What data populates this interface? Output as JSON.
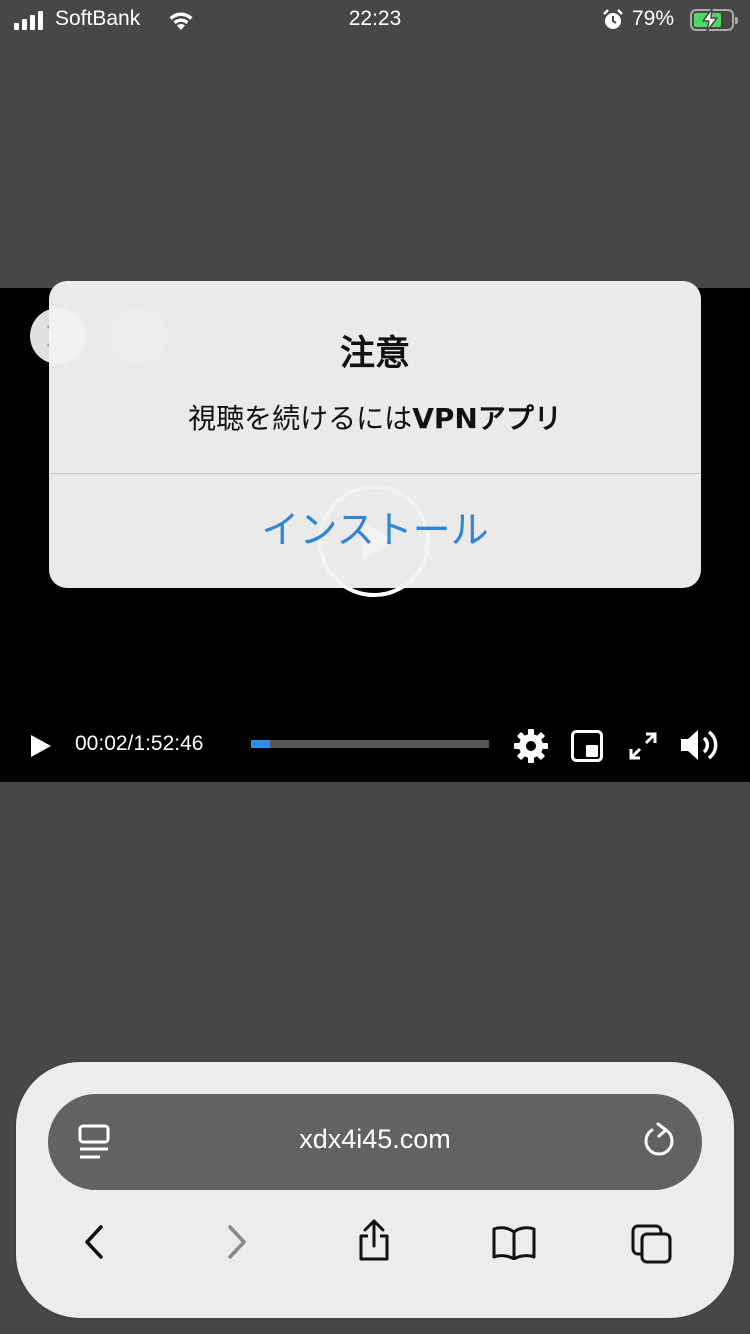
{
  "status_bar": {
    "carrier": "SoftBank",
    "time": "22:23",
    "battery_percent": "79%",
    "battery_level": 0.79,
    "charging": true,
    "icons": [
      "signal-icon",
      "wifi-icon",
      "alarm-icon",
      "battery-icon"
    ]
  },
  "player": {
    "current_time": "00:02/1:52:46",
    "progress_fraction": 0.08,
    "icons": [
      "close-icon",
      "thumbs-up-icon",
      "play-icon",
      "settings-gear-icon",
      "picture-in-picture-icon",
      "fullscreen-icon",
      "volume-icon"
    ]
  },
  "dialog": {
    "title": "注意",
    "message_prefix": "視聴を続けるには",
    "message_bold": "VPNアプリ",
    "button_label": "インストール",
    "button_color": "#2f86d6"
  },
  "browser": {
    "url": "xdx4i45.com",
    "icons": [
      "reader-icon",
      "reload-icon",
      "back-icon",
      "forward-icon",
      "share-icon",
      "bookmarks-icon",
      "tabs-icon"
    ]
  }
}
